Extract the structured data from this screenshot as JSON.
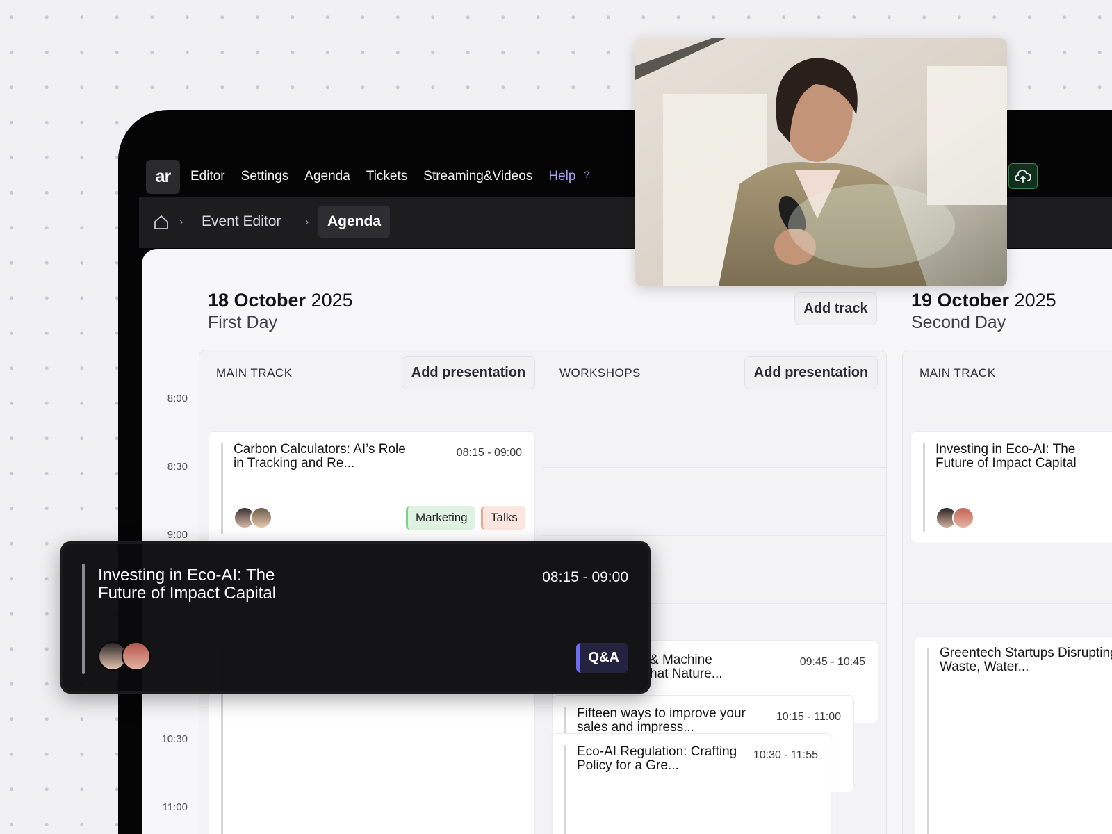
{
  "nav": {
    "logo": "ar",
    "items": [
      "Editor",
      "Settings",
      "Agenda",
      "Tickets",
      "Streaming&Videos"
    ],
    "help_label": "Help",
    "help_mark": "?"
  },
  "breadcrumb": {
    "home_icon": "home-icon",
    "items": [
      "Event Editor",
      "Agenda"
    ]
  },
  "day1": {
    "date_bold": "18 October",
    "year": "2025",
    "sub": "First Day"
  },
  "day2": {
    "date_bold": "19 October",
    "year": "2025",
    "sub": "Second Day"
  },
  "buttons": {
    "add_track": "Add track",
    "add_presentation": "Add presentation"
  },
  "tracks": {
    "main": "MAIN TRACK",
    "workshops": "WORKSHOPS"
  },
  "times": [
    "8:00",
    "8:30",
    "9:00",
    "10:30",
    "11:00"
  ],
  "cards": {
    "carbon": {
      "title": "Carbon Calculators: AI’s Role in Tracking and Re...",
      "time": "08:15 - 09:00",
      "tags": [
        "Marketing",
        "Talks"
      ]
    },
    "investing_day2": {
      "title": "Investing in Eco-AI: The Future of Impact Capital"
    },
    "machine": {
      "title_line1": "& Machine",
      "title_line2": "hat Nature...",
      "time": "09:45 - 10:45"
    },
    "fifteen": {
      "title": "Fifteen ways to improve your sales and impress...",
      "time": "10:15 - 11:00"
    },
    "regulation": {
      "title": "Eco-AI Regulation: Crafting Policy for a Gre...",
      "time": "10:30 - 11:55"
    },
    "greentech": {
      "title": "Greentech Startups Disrupting Waste, Water..."
    }
  },
  "floating": {
    "title": "Investing in Eco-AI: The Future of Impact Capital",
    "time": "08:15 - 09:00",
    "tag": "Q&A"
  },
  "colors": {
    "accent": "#a6a2f4",
    "green_tag": "#e0f3e3",
    "red_tag": "#fbe6e0",
    "qa_accent": "#6c6cf2"
  }
}
